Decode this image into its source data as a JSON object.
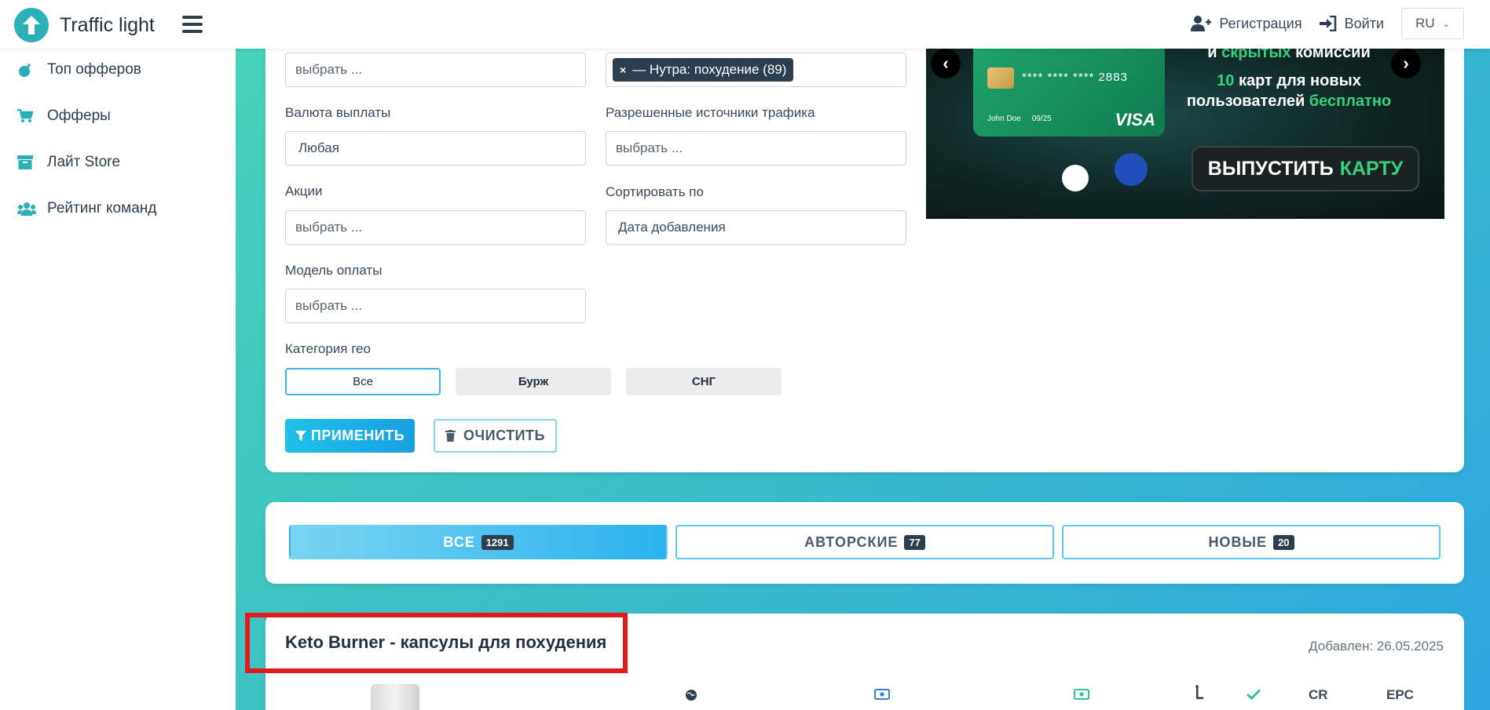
{
  "header": {
    "logo_text": "Traffic light",
    "register_label": "Регистрация",
    "login_label": "Войти",
    "language": "RU"
  },
  "sidebar": {
    "items": [
      {
        "label": "Топ офферов",
        "icon": "bomb-icon"
      },
      {
        "label": "Офферы",
        "icon": "cart-icon"
      },
      {
        "label": "Лайт Store",
        "icon": "archive-icon"
      },
      {
        "label": "Рейтинг команд",
        "icon": "users-icon"
      }
    ]
  },
  "filters": {
    "field_top_left_placeholder": "выбрать ...",
    "category_tag": "— Нутра: похудение (89)",
    "payout_currency_label": "Валюта выплаты",
    "payout_currency_value": "Любая",
    "traffic_sources_label": "Разрешенные источники трафика",
    "traffic_sources_placeholder": "выбрать ...",
    "promotions_label": "Акции",
    "promotions_placeholder": "выбрать ...",
    "sort_label": "Сортировать по",
    "sort_value": "Дата добавления",
    "payment_model_label": "Модель оплаты",
    "payment_model_placeholder": "выбрать ...",
    "geo_label": "Категория гео",
    "geo_options": [
      "Все",
      "Бурж",
      "СНГ"
    ],
    "geo_selected": "Все",
    "apply_label": "ПРИМЕНИТЬ",
    "clear_label": "ОЧИСТИТЬ"
  },
  "banner": {
    "top_line_a": "и",
    "top_line_b": "скрытых",
    "top_line_c": "комиссий",
    "card_number": "**** **** **** 2883",
    "card_holder": "John Doe",
    "card_expiry": "09/25",
    "card_brand": "VISA",
    "line1_highlight": "10",
    "line1_rest": "карт для новых",
    "line2_rest": "пользователей",
    "line2_highlight": "бесплатно",
    "cta_a": "ВЫПУСТИТЬ",
    "cta_b": "КАРТУ"
  },
  "tabs": [
    {
      "label": "ВСЕ",
      "count": "1291",
      "active": true
    },
    {
      "label": "АВТОРСКИЕ",
      "count": "77",
      "active": false
    },
    {
      "label": "НОВЫЕ",
      "count": "20",
      "active": false
    }
  ],
  "offer": {
    "title": "Keto Burner - капсулы для похудения",
    "added": "Добавлен: 26.05.2025",
    "columns": [
      "CR",
      "EPC"
    ],
    "column_icons": [
      "globe-icon",
      "money-icon",
      "money-icon",
      "hold-icon",
      "check-icon"
    ]
  },
  "colors": {
    "accent": "#2bb3ee",
    "brand_teal": "#2bb0b8",
    "highlight_red": "#e01b1b",
    "banner_green": "#34d17e"
  }
}
